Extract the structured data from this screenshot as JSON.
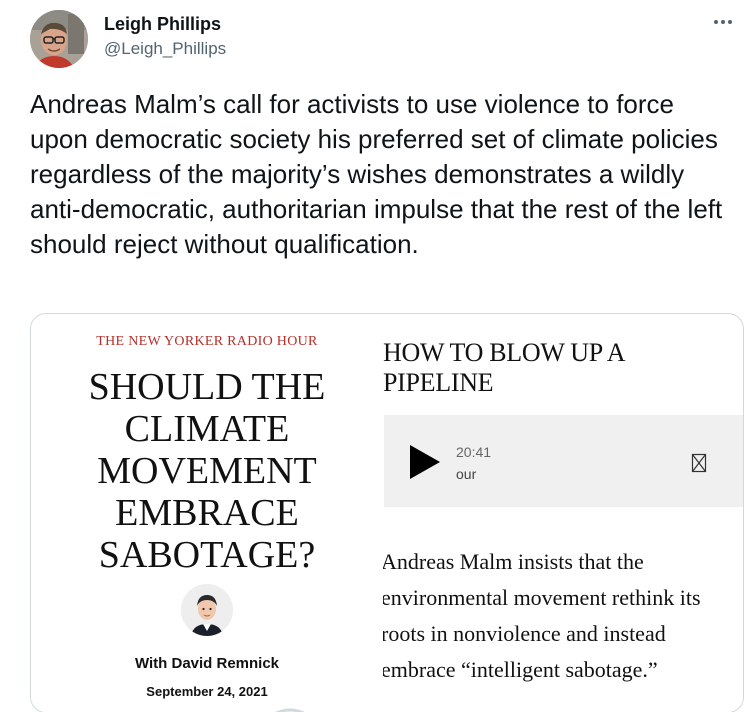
{
  "author": {
    "name": "Leigh Phillips",
    "handle": "@Leigh_Phillips"
  },
  "tweet": {
    "text": "Andreas Malm’s call for activists to use violence to force upon democratic society his preferred set of climate policies regardless of the majority’s wishes demonstrates a wildly anti-democratic, authoritarian impulse that the rest of the left should reject without qualification."
  },
  "card": {
    "show_name": "THE NEW YORKER RADIO HOUR",
    "headline_lines": [
      "SHOULD THE",
      "CLIMATE",
      "MOVEMENT",
      "EMBRACE",
      "SABOTAGE?"
    ],
    "host_line": "With David Remnick",
    "date": "September 24, 2021",
    "episode_title_lines": [
      "HOW TO BLOW UP A",
      "PIPELINE"
    ],
    "player": {
      "duration": "20:41",
      "show_truncated": "our"
    },
    "description_lines": [
      "Andreas Malm insists that the",
      "environmental movement rethink its",
      "roots in nonviolence and instead",
      "embrace “intelligent sabotage.”"
    ]
  },
  "icons": {
    "more": "more-options-icon",
    "play": "play-icon",
    "share": "share-icon"
  },
  "colors": {
    "text_primary": "#0f1419",
    "text_secondary": "#536471",
    "show_name_red": "#b5302a",
    "card_border": "#cfd9de",
    "player_bg": "#f0f0f0"
  }
}
